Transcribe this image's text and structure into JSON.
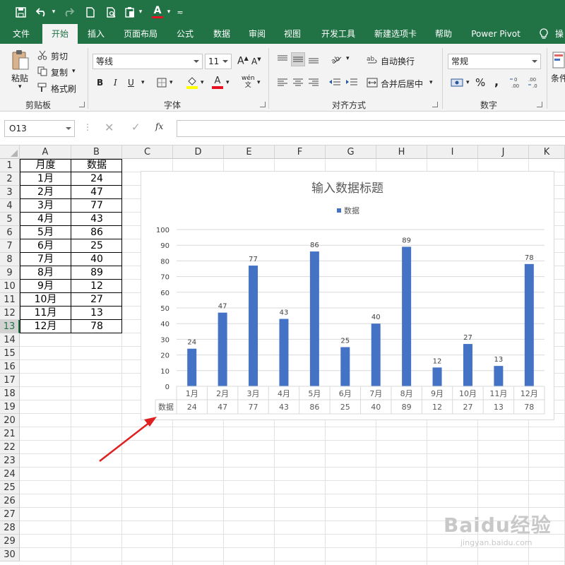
{
  "tabs": [
    "文件",
    "开始",
    "插入",
    "页面布局",
    "公式",
    "数据",
    "审阅",
    "视图",
    "开发工具",
    "新建选项卡",
    "帮助",
    "Power Pivot",
    "操"
  ],
  "active_tab_index": 1,
  "ribbon": {
    "clipboard": {
      "paste": "粘贴",
      "cut": "剪切",
      "copy": "复制",
      "format_painter": "格式刷",
      "label": "剪贴板"
    },
    "font": {
      "font_name": "等线",
      "font_size": "11",
      "label": "字体",
      "bold": "B",
      "italic": "I",
      "underline": "U",
      "grow": "A",
      "shrink": "A",
      "phonetic": "wén"
    },
    "alignment": {
      "wrap": "自动换行",
      "merge": "合并后居中",
      "label": "对齐方式"
    },
    "number": {
      "format": "常规",
      "percent": "%",
      "comma": ",",
      "inc_dec": ".00",
      "label": "数字"
    },
    "styles": {
      "cond": "条件"
    }
  },
  "formula_bar": {
    "name_box": "O13",
    "fx": "fx",
    "content": ""
  },
  "columns": [
    "A",
    "B",
    "C",
    "D",
    "E",
    "F",
    "G",
    "H",
    "I",
    "J",
    "K"
  ],
  "rows": [
    "1",
    "2",
    "3",
    "4",
    "5",
    "6",
    "7",
    "8",
    "9",
    "10",
    "11",
    "12",
    "13",
    "14",
    "15",
    "16",
    "17",
    "18",
    "19",
    "20",
    "21",
    "22",
    "23",
    "24",
    "25",
    "26",
    "27",
    "28",
    "29",
    "30"
  ],
  "selected_row": "13",
  "table": {
    "headers": [
      "月度",
      "数据"
    ],
    "rows": [
      [
        "1月",
        "24"
      ],
      [
        "2月",
        "47"
      ],
      [
        "3月",
        "77"
      ],
      [
        "4月",
        "43"
      ],
      [
        "5月",
        "86"
      ],
      [
        "6月",
        "25"
      ],
      [
        "7月",
        "40"
      ],
      [
        "8月",
        "89"
      ],
      [
        "9月",
        "12"
      ],
      [
        "10月",
        "27"
      ],
      [
        "11月",
        "13"
      ],
      [
        "12月",
        "78"
      ]
    ]
  },
  "chart_data": {
    "type": "bar",
    "title": "输入数据标题",
    "categories": [
      "1月",
      "2月",
      "3月",
      "4月",
      "5月",
      "6月",
      "7月",
      "8月",
      "9月",
      "10月",
      "11月",
      "12月"
    ],
    "series": [
      {
        "name": "数据",
        "values": [
          24,
          47,
          77,
          43,
          86,
          25,
          40,
          89,
          12,
          27,
          13,
          78
        ],
        "color": "#4472c4"
      }
    ],
    "ylim": [
      0,
      100
    ],
    "y_ticks": [
      0,
      10,
      20,
      30,
      40,
      50,
      60,
      70,
      80,
      90,
      100
    ],
    "legend": "top",
    "data_labels": true,
    "data_table": true,
    "grid": true
  },
  "watermark": {
    "brand": "Baidu经验",
    "url": "jingyan.baidu.com"
  }
}
